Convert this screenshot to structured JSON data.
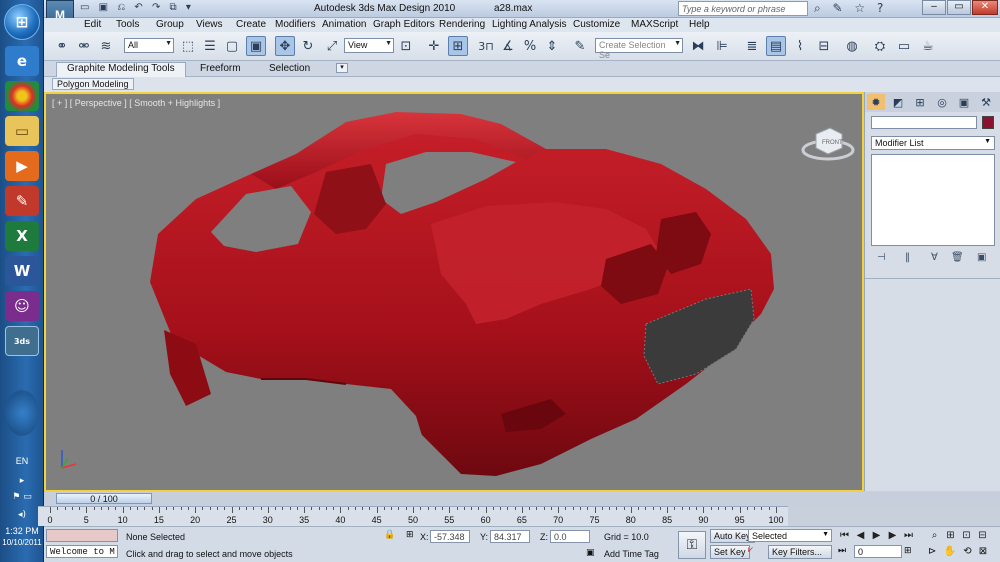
{
  "window": {
    "title": "Autodesk 3ds Max Design 2010",
    "file": "a28.max",
    "search_placeholder": "Type a keyword or phrase"
  },
  "menu": [
    "Edit",
    "Tools",
    "Group",
    "Views",
    "Create",
    "Modifiers",
    "Animation",
    "Graph Editors",
    "Rendering",
    "Lighting Analysis",
    "Customize",
    "MAXScript",
    "Help"
  ],
  "toolbar": {
    "filter_value": "All",
    "refcoord_value": "View",
    "snap_label": "3",
    "selection_set_placeholder": "Create Selection Se"
  },
  "ribbon": {
    "tabs": [
      "Graphite Modeling Tools",
      "Freeform",
      "Selection"
    ],
    "active_tab": "Graphite Modeling Tools",
    "sub_tab": "Polygon Modeling"
  },
  "viewport": {
    "label": "[ + ] [ Perspective ] [ Smooth + Highlights ]",
    "viewcube_label": "FRONT"
  },
  "command_panel": {
    "object_name": "",
    "object_color": "#8a1130",
    "modifier_list": "Modifier List"
  },
  "timeline": {
    "slider_label": "0 / 100",
    "ticks": [
      "0",
      "5",
      "10",
      "15",
      "20",
      "25",
      "30",
      "35",
      "40",
      "45",
      "50",
      "55",
      "60",
      "65",
      "70",
      "75",
      "80",
      "85",
      "90",
      "95",
      "100"
    ]
  },
  "status": {
    "maxscript_prompt": "Welcome to M",
    "selection": "None Selected",
    "prompt": "Click and drag to select and move objects",
    "x_label": "X:",
    "x_value": "-57.348",
    "y_label": "Y:",
    "y_value": "84.317",
    "z_label": "Z:",
    "z_value": "0.0",
    "grid": "Grid = 10.0",
    "add_time_tag": "Add Time Tag",
    "auto_key": "Auto Key",
    "set_key": "Set Key",
    "key_mode": "Selected",
    "key_filters": "Key Filters...",
    "frame": "0"
  },
  "taskbar": {
    "lang": "EN",
    "time": "1:32 PM",
    "date": "10/10/2011",
    "app_label": "3ds"
  },
  "colors": {
    "viewport_border": "#f2d13b",
    "car": "#b5121b",
    "viewport_bg": "#7f7f7f"
  }
}
